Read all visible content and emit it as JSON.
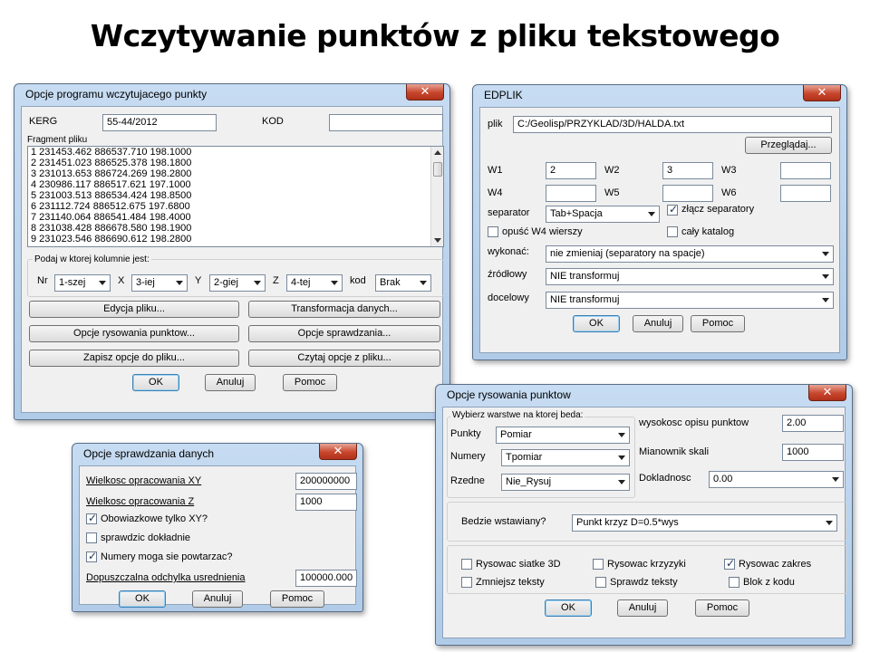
{
  "slide": {
    "title": "Wczytywanie punktów z pliku tekstowego"
  },
  "win1": {
    "title": "Opcje programu wczytujacego punkty",
    "kerg_label": "KERG",
    "kerg_value": "55-44/2012",
    "kod_label": "KOD",
    "kod_value": "",
    "fragment_label": "Fragment pliku",
    "fragment_lines": [
      "1 231453.462 886537.710 198.1000",
      "2 231451.023 886525.378 198.1800",
      "3 231013.653 886724.269 198.2800",
      "4 230986.117 886517.621 197.1000",
      "5 231003.513 886534.424 198.8500",
      "6 231112.724 886512.675 197.6800",
      "7 231140.064 886541.484 198.4000",
      "8 231038.428 886678.580 198.1900",
      "9 231023.546 886690.612 198.2800"
    ],
    "columns_group": "Podaj w ktorej kolumnie jest:",
    "nr_label": "Nr",
    "nr_value": "1-szej",
    "x_label": "X",
    "x_value": "3-iej",
    "y_label": "Y",
    "y_value": "2-giej",
    "z_label": "Z",
    "z_value": "4-tej",
    "kod_col_label": "kod",
    "kod_col_value": "Brak",
    "btn_edycja": "Edycja pliku...",
    "btn_transformacja": "Transformacja danych...",
    "btn_opcje_rys": "Opcje rysowania punktow...",
    "btn_opcje_spr": "Opcje sprawdzania...",
    "btn_zapisz": "Zapisz opcje do pliku...",
    "btn_czytaj": "Czytaj opcje z pliku...",
    "ok": "OK",
    "cancel": "Anuluj",
    "help": "Pomoc"
  },
  "win2": {
    "title": "EDPLIK",
    "plik_label": "plik",
    "plik_value": "C:/Geolisp/PRZYKLAD/3D/HALDA.txt",
    "przegladaj": "Przeglądaj...",
    "w1_label": "W1",
    "w1_value": "2",
    "w2_label": "W2",
    "w2_value": "3",
    "w3_label": "W3",
    "w3_value": "",
    "w4_label": "W4",
    "w4_value": "",
    "w5_label": "W5",
    "w5_value": "",
    "w6_label": "W6",
    "w6_value": "",
    "separator_label": "separator",
    "separator_value": "Tab+Spacja",
    "zlacz_label": "złącz separatory",
    "zlacz_checked": true,
    "opusc_label": "opuść W4 wierszy",
    "opusc_checked": false,
    "caly_label": "cały katalog",
    "caly_checked": false,
    "wykonac_label": "wykonać:",
    "wykonac_value": "nie zmieniaj (separatory na spacje)",
    "zrodlowy_label": "źródłowy",
    "zrodlowy_value": "NIE transformuj",
    "docelowy_label": "docelowy",
    "docelowy_value": "NIE transformuj",
    "ok": "OK",
    "cancel": "Anuluj",
    "help": "Pomoc"
  },
  "win3": {
    "title": "Opcje sprawdzania danych",
    "xy_label": "Wielkosc opracowania XY",
    "xy_value": "200000000",
    "z_label": "Wielkosc opracowania Z",
    "z_value": "1000",
    "obow_label": "Obowiazkowe tylko XY?",
    "obow_checked": true,
    "spr_label": "sprawdzic dokładnie",
    "spr_checked": false,
    "num_label": "Numery moga sie powtarzac?",
    "num_checked": true,
    "odch_label": "Dopuszczalna odchylka usrednienia",
    "odch_value": "100000.000",
    "ok": "OK",
    "cancel": "Anuluj",
    "help": "Pomoc"
  },
  "win4": {
    "title": "Opcje rysowania punktow",
    "layers_group": "Wybierz warstwe na ktorej beda:",
    "punkty_label": "Punkty",
    "punkty_value": "Pomiar",
    "numery_label": "Numery",
    "numery_value": "Tpomiar",
    "rzedne_label": "Rzedne",
    "rzedne_value": "Nie_Rysuj",
    "wys_label": "wysokosc opisu punktow",
    "wys_value": "2.00",
    "mian_label": "Mianownik skali",
    "mian_value": "1000",
    "dokl_label": "Dokladnosc",
    "dokl_value": "0.00",
    "bedzie_label": "Bedzie wstawiany?",
    "bedzie_value": "Punkt krzyz D=0.5*wys",
    "cb_siatke": "Rysowac siatke 3D",
    "cb_siatke_checked": false,
    "cb_krzyzyki": "Rysowac krzyzyki",
    "cb_krzyzyki_checked": false,
    "cb_zakres": "Rysowac zakres",
    "cb_zakres_checked": true,
    "cb_zmniejsz": "Zmniejsz teksty",
    "cb_zmniejsz_checked": false,
    "cb_sprawdz": "Sprawdz teksty",
    "cb_sprawdz_checked": false,
    "cb_blok": "Blok z kodu",
    "cb_blok_checked": false,
    "ok": "OK",
    "cancel": "Anuluj",
    "help": "Pomoc"
  }
}
